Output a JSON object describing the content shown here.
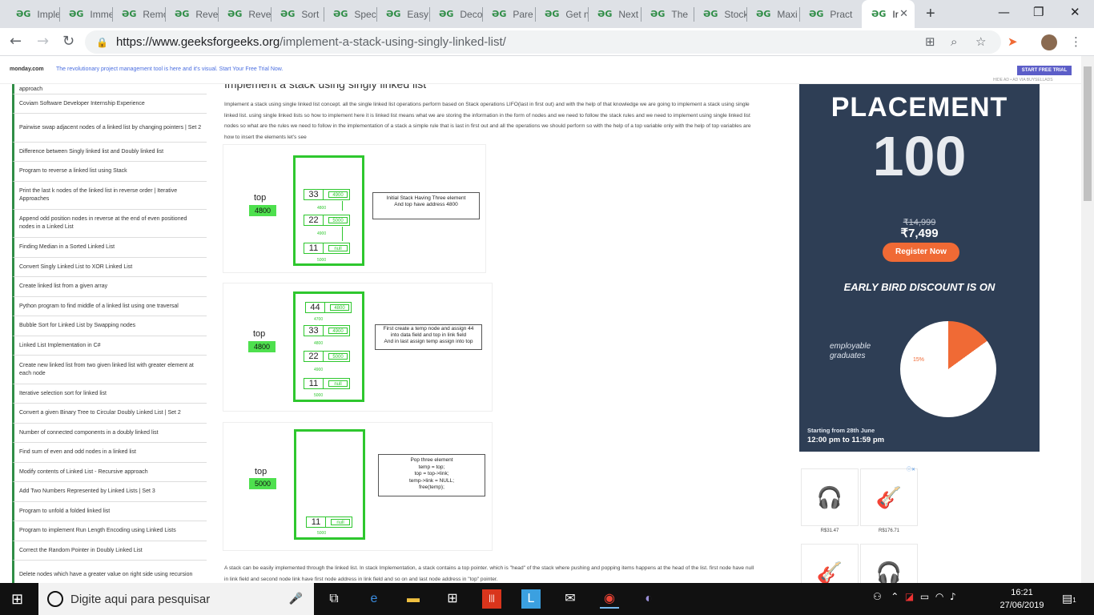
{
  "tabs": [
    {
      "title": "Imple"
    },
    {
      "title": "Imme"
    },
    {
      "title": "Remo"
    },
    {
      "title": "Reve"
    },
    {
      "title": "Reve"
    },
    {
      "title": "Sort"
    },
    {
      "title": "Spec"
    },
    {
      "title": "Easy"
    },
    {
      "title": "Deco"
    },
    {
      "title": "Pare"
    },
    {
      "title": "Get n"
    },
    {
      "title": "Next"
    },
    {
      "title": "The"
    },
    {
      "title": "Stock"
    },
    {
      "title": "Maxi"
    },
    {
      "title": "Pract"
    },
    {
      "title": "Ir"
    }
  ],
  "favicon": "ƏG",
  "url": {
    "host": "https://www.geeksforgeeks.org",
    "path": "/implement-a-stack-using-singly-linked-list/"
  },
  "adbar": {
    "logo": "monday.com",
    "text": "The revolutionary project management tool is here and it's visual. Start Your Free Trial Now.",
    "cta": "START FREE TRIAL",
    "hide": "HIDE AD • AD VIA BUYSELLADS"
  },
  "sidebar": {
    "items": [
      "approach",
      "Coviam Software Developer Internship Experience",
      "Pairwise swap adjacent nodes of a linked list by changing pointers | Set 2",
      "Difference between Singly linked list and Doubly linked list",
      "Program to reverse a linked list using Stack",
      "Print the last k nodes of the linked list in reverse order | Iterative Approaches",
      "Append odd position nodes in reverse at the end of even positioned nodes in a Linked List",
      "Finding Median in a Sorted Linked List",
      "Convert Singly Linked List to XOR Linked List",
      "Create linked list from a given array",
      "Python program to find middle of a linked list using one traversal",
      "Bubble Sort for Linked List by Swapping nodes",
      "Linked List Implementation in C#",
      "Create new linked list from two given linked list with greater element at each node",
      "Iterative selection sort for linked list",
      "Convert a given Binary Tree to Circular Doubly Linked List | Set 2",
      "Number of connected components in a doubly linked list",
      "Find sum of even and odd nodes in a linked list",
      "Modify contents of Linked List - Recursive approach",
      "Add Two Numbers Represented by Linked Lists | Set 3",
      "Program to unfold a folded linked list",
      "Program to implement Run Length Encoding using Linked Lists",
      "Correct the Random Pointer in Doubly Linked List",
      "Delete nodes which have a greater value on right side using recursion"
    ]
  },
  "article": {
    "title": "Implement a stack using singly linked list",
    "intro": "Implement a stack using single linked list concept. all the single linked list operations perform based on Stack operations LIFO(last in first out) and with the help of that knowledge we are going to implement a stack using single linked list. using single linked lists so how to implement here it is linked list means what we are storing the information in the form of nodes and we need to follow the stack rules and we need to implement using single linked list nodes so what are the rules we need to follow in the implementation of a stack a simple rule that is last in first out and all the operations we should perform so with the help of a top variable only with the help of top variables are how to insert the elements let's see",
    "bottom": "A stack can be easily implemented through the linked list. In stack Implementation, a stack contains a top pointer. which is \"head\" of the stack where pushing and popping items happens at the head of the list. first node have null in link field and second node link have first node address in link field and so on and last node address in \"top\" pointer."
  },
  "figures": {
    "top_label": "top",
    "fig1": {
      "top_value": "4800",
      "nodes": [
        {
          "data": "33",
          "link": "4900",
          "addr": "4800"
        },
        {
          "data": "22",
          "link": "5000",
          "addr": "4900"
        },
        {
          "data": "11",
          "link": "null",
          "addr": "5000"
        }
      ],
      "note": [
        "Initial Stack Having Three element",
        "And top have address 4800"
      ]
    },
    "fig2": {
      "top_value": "4800",
      "nodes": [
        {
          "data": "44",
          "link": "4800",
          "addr": "4700"
        },
        {
          "data": "33",
          "link": "4900",
          "addr": "4800"
        },
        {
          "data": "22",
          "link": "5000",
          "addr": "4900"
        },
        {
          "data": "11",
          "link": "null",
          "addr": "5000"
        }
      ],
      "note": [
        "First create a temp node and assign 44",
        "into data field and top in link field",
        "And in last assign temp assign into top"
      ]
    },
    "fig3": {
      "top_value": "5000",
      "nodes": [
        {
          "data": "11",
          "link": "null",
          "addr": "5000"
        }
      ],
      "note": [
        "Pop three  element",
        "temp = top;",
        "top = top->link;",
        "temp->link = NULL;",
        "free(temp);"
      ]
    }
  },
  "adright": {
    "title": "PLACEMENT",
    "hundred": "100",
    "old_price": "₹14,999",
    "new_price": "₹7,499",
    "register": "Register Now",
    "early_bird": "EARLY BIRD DISCOUNT IS ON",
    "employable": "employable",
    "graduates": "graduates",
    "pct": "15%",
    "starting": "Starting from 28th June",
    "time": "12:00 pm to 11:59 pm",
    "accent": "#f06a35"
  },
  "products": [
    {
      "icon": "headphones-icon",
      "price": "R$31.47"
    },
    {
      "icon": "guitar-icon",
      "price": "R$176.71"
    },
    {
      "icon": "guitar-icon",
      "price": ""
    },
    {
      "icon": "headphones-icon",
      "price": ""
    }
  ],
  "taskbar": {
    "search_placeholder": "Digite aqui para pesquisar",
    "time": "16:21",
    "date": "27/06/2019",
    "notifications": "1"
  },
  "colors": {
    "gfg_green": "#2f8d46",
    "stack_green": "#2ec72e",
    "chrome_tabbar": "#dee1e6"
  }
}
